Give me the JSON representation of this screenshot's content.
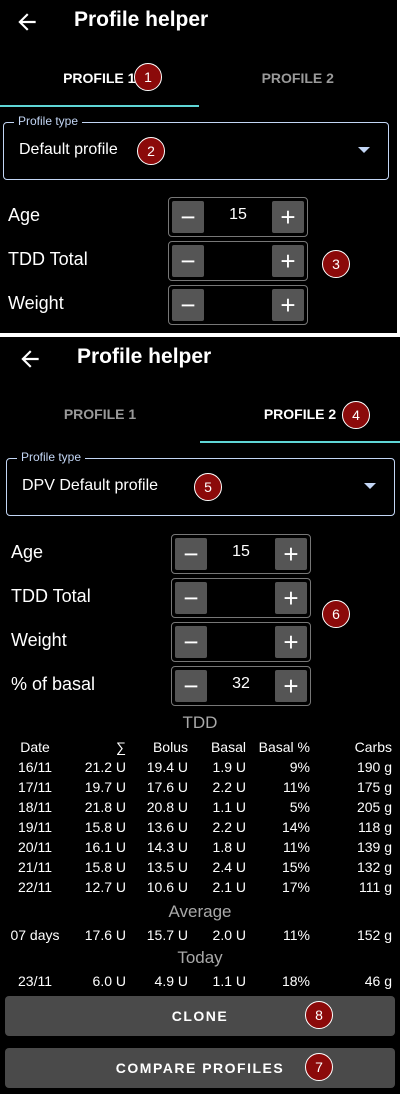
{
  "screen1": {
    "title": "Profile helper",
    "tabs": [
      "PROFILE 1",
      "PROFILE 2"
    ],
    "profile_type": {
      "legend": "Profile type",
      "value": "Default profile"
    },
    "fields": [
      {
        "label": "Age",
        "value": "15"
      },
      {
        "label": "TDD Total",
        "value": ""
      },
      {
        "label": "Weight",
        "value": ""
      }
    ],
    "badges": [
      "1",
      "2",
      "3"
    ]
  },
  "screen2": {
    "title": "Profile helper",
    "tabs": [
      "PROFILE 1",
      "PROFILE 2"
    ],
    "profile_type": {
      "legend": "Profile type",
      "value": "DPV Default profile"
    },
    "fields": [
      {
        "label": "Age",
        "value": "15"
      },
      {
        "label": "TDD Total",
        "value": ""
      },
      {
        "label": "Weight",
        "value": ""
      },
      {
        "label": "% of basal",
        "value": "32"
      }
    ],
    "tdd": {
      "title": "TDD",
      "headers": [
        "Date",
        "∑",
        "Bolus",
        "Basal",
        "Basal %",
        "Carbs"
      ],
      "rows": [
        [
          "16/11",
          "21.2 U",
          "19.4 U",
          "1.9 U",
          "9%",
          "190 g"
        ],
        [
          "17/11",
          "19.7 U",
          "17.6 U",
          "2.2 U",
          "11%",
          "175 g"
        ],
        [
          "18/11",
          "21.8 U",
          "20.8 U",
          "1.1 U",
          "5%",
          "205 g"
        ],
        [
          "19/11",
          "15.8 U",
          "13.6 U",
          "2.2 U",
          "14%",
          "118 g"
        ],
        [
          "20/11",
          "16.1 U",
          "14.3 U",
          "1.8 U",
          "11%",
          "139 g"
        ],
        [
          "21/11",
          "15.8 U",
          "13.5 U",
          "2.4 U",
          "15%",
          "132 g"
        ],
        [
          "22/11",
          "12.7 U",
          "10.6 U",
          "2.1 U",
          "17%",
          "111 g"
        ]
      ],
      "average_title": "Average",
      "average": [
        "07 days",
        "17.6 U",
        "15.7 U",
        "2.0 U",
        "11%",
        "152 g"
      ],
      "today_title": "Today",
      "today": [
        "23/11",
        "6.0 U",
        "4.9 U",
        "1.1 U",
        "18%",
        "46 g"
      ]
    },
    "buttons": {
      "clone": "CLONE",
      "compare": "COMPARE PROFILES"
    },
    "badges": [
      "4",
      "5",
      "6",
      "7",
      "8"
    ]
  },
  "colors": {
    "background": "#000000",
    "accent": "#5fd6d6",
    "outline": "#c3d6f5",
    "button": "#4a4a4a",
    "badge": "#8b0a0a"
  },
  "icons": {
    "back": "arrow-left-icon",
    "dropdown": "caret-down-icon"
  }
}
